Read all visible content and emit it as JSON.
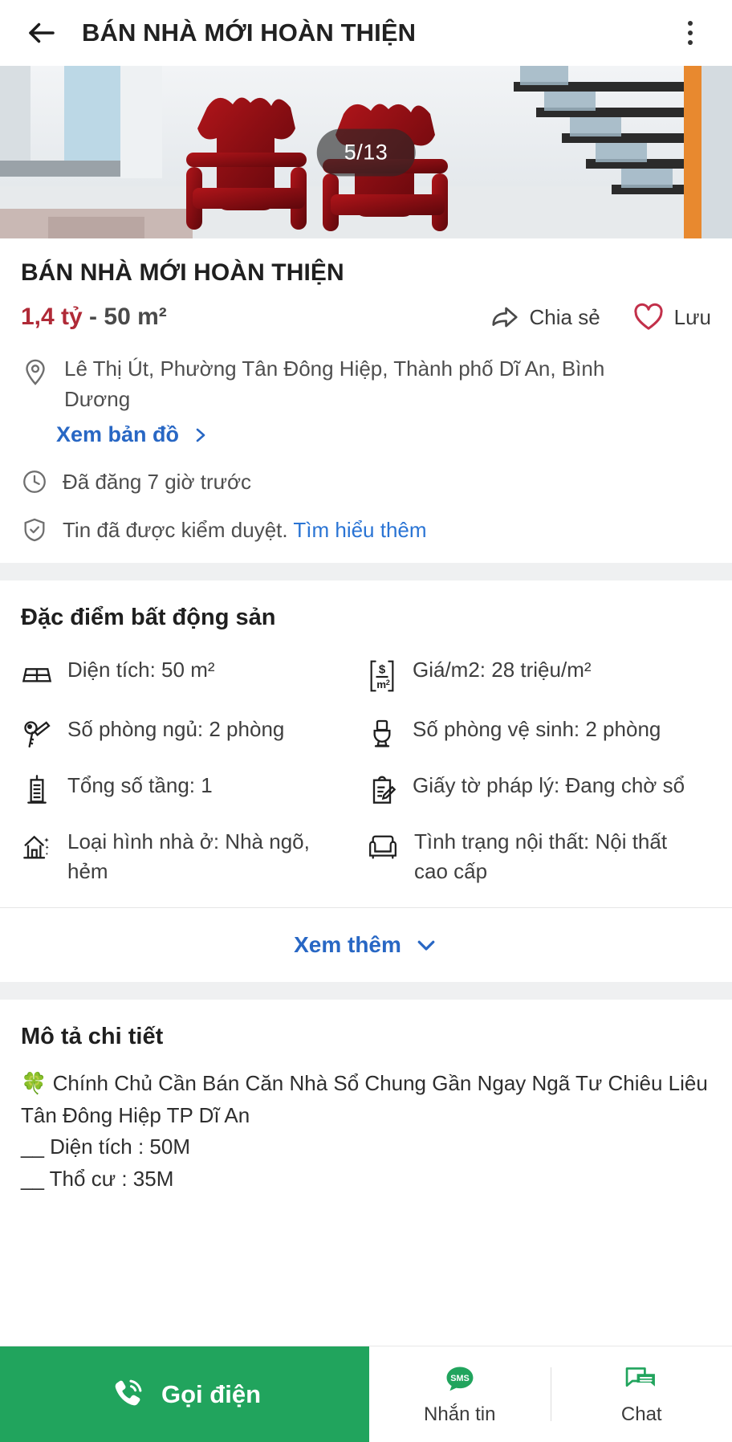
{
  "appbar": {
    "title": "BÁN NHÀ MỚI HOÀN THIỆN",
    "back_icon": "back-arrow-icon",
    "menu_icon": "kebab-menu-icon"
  },
  "gallery": {
    "counter": "5/13",
    "photo_description": "interior room with red carved wooden chairs and white staircase"
  },
  "listing": {
    "title": "BÁN NHÀ MỚI HOÀN THIỆN",
    "price": "1,4 tỷ",
    "price_suffix": " - 50 m²",
    "price_color": "#b02a37",
    "address": "Lê Thị Út, Phường Tân Đông Hiệp, Thành phố Dĩ An, Bình Dương",
    "map_link": "Xem bản đồ",
    "posted_time": "Đã đăng 7 giờ trước",
    "verified_text": "Tin đã được kiểm duyệt.",
    "verified_link": "Tìm hiểu thêm",
    "share_label": "Chia sẻ",
    "save_label": "Lưu"
  },
  "features": {
    "heading": "Đặc điểm bất động sản",
    "items": [
      {
        "icon": "area-grid-icon",
        "label": "Diện tích: 50 m²"
      },
      {
        "icon": "price-per-sqm-icon",
        "label": "Giá/m2: 28 triệu/m²"
      },
      {
        "icon": "key-icon",
        "label": "Số phòng ngủ: 2 phòng"
      },
      {
        "icon": "toilet-icon",
        "label": "Số phòng vệ sinh: 2 phòng"
      },
      {
        "icon": "building-icon",
        "label": "Tổng số tầng: 1"
      },
      {
        "icon": "legal-document-icon",
        "label": "Giấy tờ pháp lý: Đang chờ sổ"
      },
      {
        "icon": "house-icon",
        "label": "Loại hình nhà ở: Nhà ngõ, hẻm"
      },
      {
        "icon": "armchair-icon",
        "label": "Tình trạng nội thất: Nội thất cao cấp"
      }
    ],
    "expand_label": "Xem thêm"
  },
  "description": {
    "heading": "Mô tả chi tiết",
    "emoji": "🍀",
    "line1": "Chính Chủ Cần Bán Căn Nhà Sổ Chung Gần Ngay Ngã Tư Chiêu Liêu Tân Đông Hiệp TP Dĩ An",
    "line2": "__ Diện tích : 50M",
    "line3": "__ Thổ cư  : 35M"
  },
  "bottombar": {
    "call_label": "Gọi điện",
    "call_color": "#21a45d",
    "sms_label": "Nhắn tin",
    "sms_badge": "SMS",
    "chat_label": "Chat"
  }
}
